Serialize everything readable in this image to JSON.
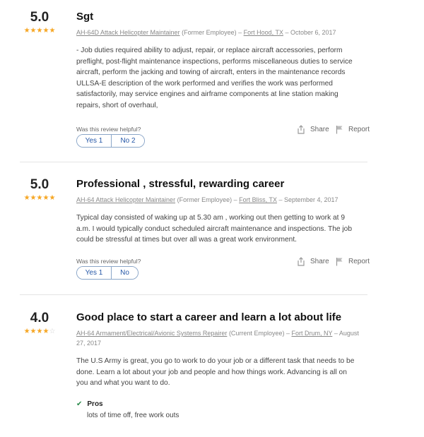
{
  "reviews": [
    {
      "rating": "5.0",
      "stars_filled": 5,
      "title": "Sgt",
      "job_title": "AH-64D Attack Helicopter Maintainer",
      "status": "(Former Employee) –",
      "location": "Fort Hood, TX",
      "date": "– October 6, 2017",
      "text": "- Job duties required ability to adjust, repair, or replace aircraft accessories, perform preflight, post-flight maintenance inspections, performs miscellaneous duties to service aircraft, perform the jacking and towing of aircraft, enters in the maintenance records ULLSA-E description of the work performed and verifies the work was performed satisfactorily, may service engines and airframe components at line station making repairs, short of overhaul,",
      "helpful_label": "Was this review helpful?",
      "yes_label": "Yes 1",
      "no_label": "No 2",
      "share_label": "Share",
      "report_label": "Report"
    },
    {
      "rating": "5.0",
      "stars_filled": 5,
      "title": "Professional , stressful, rewarding career",
      "job_title": "AH-64 Attack Helicopter Maintainer",
      "status": "(Former Employee) –",
      "location": "Fort Bliss, TX",
      "date": "– September 4, 2017",
      "text": "Typical day consisted of waking up at 5.30 am , working out then getting to work at 9 a.m. I would typically conduct scheduled aircraft maintenance and inspections. The job could be stressful at times but over all was a great work environment.",
      "helpful_label": "Was this review helpful?",
      "yes_label": "Yes 1",
      "no_label": "No",
      "share_label": "Share",
      "report_label": "Report"
    },
    {
      "rating": "4.0",
      "stars_filled": 4,
      "title": "Good place to start a career and learn a lot about life",
      "job_title": "AH-64 Armament/Electrical/Avionic Systems Repairer",
      "status": "(Current Employee) –",
      "location": "Fort Drum, NY",
      "date": "– August 27, 2017",
      "text": "The U.S Army is great, you go to work to do your job or a different task that needs to be done. Learn a lot about your job and people and how things work. Advancing is all on you and what you want to do.",
      "pros_label": "Pros",
      "pros_text": "lots of time off, free work outs"
    }
  ],
  "colors": {
    "star": "#f6a623",
    "link": "#2557a7",
    "check": "#2a8a4a"
  }
}
